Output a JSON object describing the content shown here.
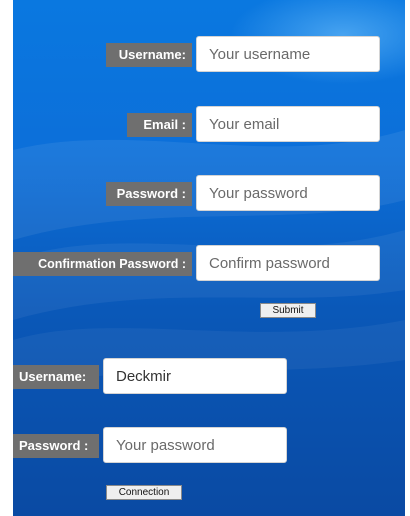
{
  "register": {
    "username_label": "Username:",
    "username_placeholder": "Your username",
    "email_label": "Email :",
    "email_placeholder": "Your email",
    "password_label": "Password :",
    "password_placeholder": "Your password",
    "confirm_label": "Confirmation Password :",
    "confirm_placeholder": "Confirm password",
    "submit_label": "Submit"
  },
  "login": {
    "username_label": "Username:",
    "username_value": "Deckmir",
    "password_label": "Password :",
    "password_placeholder": "Your password",
    "connection_label": "Connection"
  }
}
